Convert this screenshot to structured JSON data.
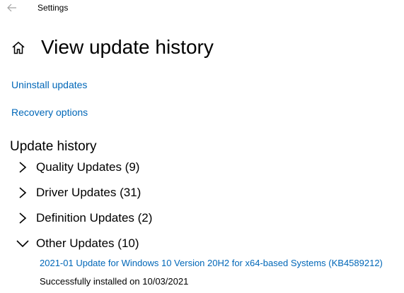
{
  "window": {
    "title": "Settings"
  },
  "header": {
    "title": "View update history"
  },
  "links": {
    "uninstall": "Uninstall updates",
    "recovery": "Recovery options"
  },
  "history": {
    "heading": "Update history",
    "groups": [
      {
        "label": "Quality Updates (9)",
        "expanded": false
      },
      {
        "label": "Driver Updates (31)",
        "expanded": false
      },
      {
        "label": "Definition Updates (2)",
        "expanded": false
      },
      {
        "label": "Other Updates (10)",
        "expanded": true
      }
    ],
    "other_entries": [
      {
        "name": "2021-01 Update for Windows 10 Version 20H2 for x64-based Systems (KB4589212)",
        "status": "Successfully installed on 10/03/2021"
      }
    ]
  },
  "icons": {
    "back": "back-arrow-icon",
    "home": "home-icon",
    "collapsed": "chevron-right-icon",
    "expanded": "chevron-down-icon"
  },
  "colors": {
    "link": "#0067b8",
    "text": "#000000",
    "background": "#ffffff",
    "back_arrow": "#a0a0a0"
  }
}
